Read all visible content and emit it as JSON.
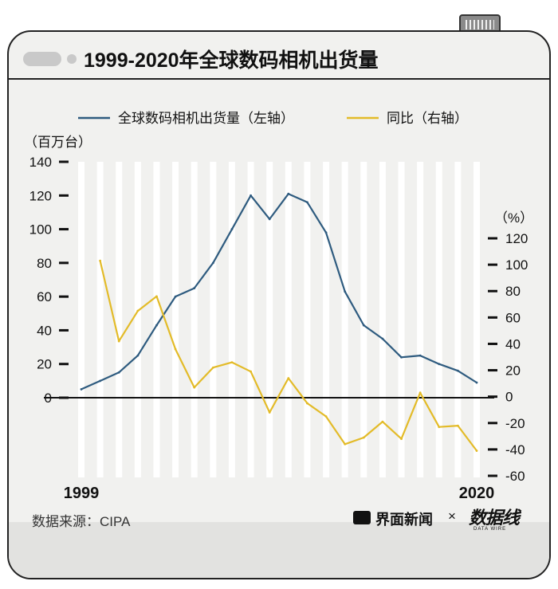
{
  "title": "1999-2020年全球数码相机出货量",
  "source": "数据来源：CIPA",
  "brand": "界面新闻",
  "brand_sep": "×",
  "brand2": "数据线",
  "brand2_sub": "DATA WIRE",
  "colors": {
    "primary": "#2e5b7f",
    "secondary": "#e3bb28",
    "background": "#f1f1ef"
  },
  "chart_data": {
    "type": "line",
    "title": "1999-2020年全球数码相机出货量",
    "left_unit": "（百万台）",
    "right_unit": "（%）",
    "x": [
      1999,
      2000,
      2001,
      2002,
      2003,
      2004,
      2005,
      2006,
      2007,
      2008,
      2009,
      2010,
      2011,
      2012,
      2013,
      2014,
      2015,
      2016,
      2017,
      2018,
      2019,
      2020
    ],
    "x_tick_labels": [
      "1999",
      "2020"
    ],
    "left_axis": {
      "ylim": [
        0,
        140
      ],
      "ticks": [
        "0",
        "20",
        "40",
        "60",
        "80",
        "100",
        "120",
        "140"
      ]
    },
    "right_axis": {
      "ylim": [
        -60,
        120
      ],
      "ticks": [
        "-60",
        "-40",
        "-20",
        "0",
        "20",
        "40",
        "60",
        "80",
        "100",
        "120"
      ]
    },
    "series": [
      {
        "name": "全球数码相机出货量（左轴）",
        "axis": "left",
        "values": [
          5,
          10,
          15,
          25,
          43,
          60,
          65,
          80,
          100,
          120,
          106,
          121,
          116,
          98,
          63,
          43,
          35,
          24,
          25,
          20,
          16,
          9
        ]
      },
      {
        "name": "同比（右轴）",
        "axis": "right",
        "values": [
          null,
          103,
          42,
          65,
          76,
          36,
          7,
          22,
          26,
          19,
          -12,
          14,
          -5,
          -15,
          -36,
          -31,
          -19,
          -32,
          3,
          -23,
          -22,
          -41
        ]
      }
    ],
    "grid": "vertical-bands",
    "legend": "top"
  }
}
